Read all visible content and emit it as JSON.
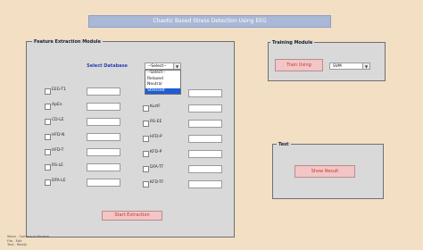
{
  "title": "Chaotic Based Stress Detection Using EEG",
  "feature_module": {
    "label": "Feature Extraction Module",
    "select_db_label": "Select Database",
    "db_dropdown": {
      "selected": "--Select--",
      "options": [
        "--Select--",
        "Relaxed",
        "Neutral",
        "Stressed"
      ],
      "highlighted_index": 3
    },
    "left_features": [
      "EEG-T1",
      "ApEn",
      "CD-LE",
      "HFD-N",
      "HFD-T",
      "RS-LE",
      "DFA-LE"
    ],
    "right_features": [
      "",
      "KurtF",
      "RS-EE",
      "HFD-P",
      "KFD-P",
      "DFA-TT",
      "KFD-TF"
    ],
    "start_button": "Start Extraction"
  },
  "training_module": {
    "label": "Training Module",
    "train_button": "Train Using",
    "classifier_select": "SVM"
  },
  "result_panel": {
    "label": "Test",
    "button": "Show Result"
  },
  "status_lines": [
    "Wave - Command Window",
    "File - Edit",
    "Text - Ready"
  ]
}
